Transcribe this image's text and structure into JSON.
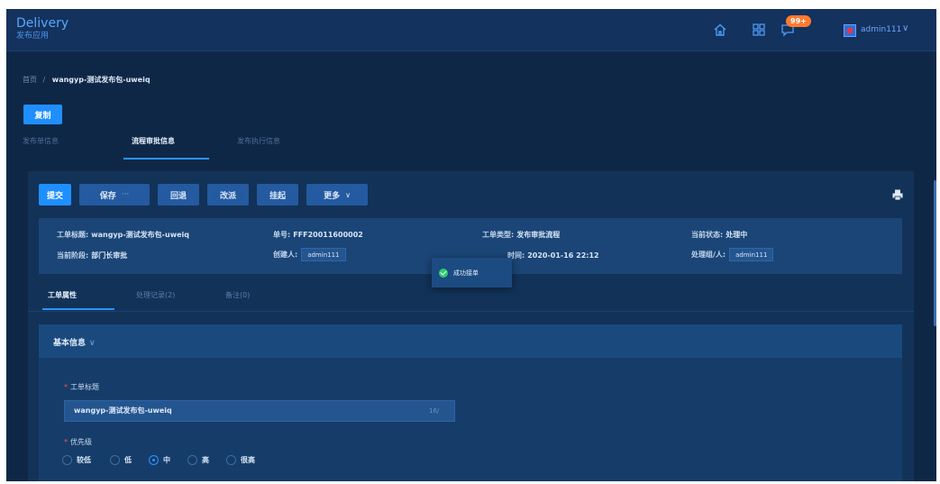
{
  "app": {
    "name": "Delivery",
    "subtitle": "发布应用"
  },
  "topbar": {
    "home_icon": "home-icon",
    "apps_icon": "apps-grid-icon",
    "message_icon": "message-icon",
    "badge": "99+",
    "username": "admin111"
  },
  "breadcrumb": {
    "root": "首页",
    "separator": "/",
    "current": "wangyp-测试发布包-uweiq"
  },
  "copy_button": "复制",
  "page_tabs": [
    "发布单信息",
    "流程审批信息",
    "发布执行信息"
  ],
  "toolbar": {
    "submit": "提交",
    "save": "保存",
    "save_more": "···",
    "rollback": "回退",
    "reassign": "改派",
    "suspend": "挂起",
    "more": "更多",
    "more_caret": "∨"
  },
  "info": {
    "title_label": "工单标题:",
    "title_value": "wangyp-测试发布包-uweiq",
    "no_label": "单号:",
    "no_value": "FFF20011600002",
    "type_label": "工单类型:",
    "type_value": "发布审批流程",
    "status_label": "当前状态:",
    "status_value": "处理中",
    "stage_label": "当前阶段:",
    "stage_value": "部门长审批",
    "creator_label": "创建人:",
    "creator_value": "admin111",
    "time_label": "时间:",
    "time_value": "2020-01-16 22:12",
    "handler_label": "处理组/人:",
    "handler_value": "admin111"
  },
  "toast": {
    "message": "成功接单"
  },
  "sub_tabs": [
    "工单属性",
    "处理记录(2)",
    "备注(0)"
  ],
  "section": {
    "title": "基本信息",
    "chevron": "∨",
    "title_field_label": "工单标题",
    "title_field_value": "wangyp-测试发布包-uweiq",
    "title_field_count": "16/",
    "priority_label": "优先级",
    "priority_options": [
      "较低",
      "低",
      "中",
      "高",
      "很高"
    ],
    "priority_selected": "中"
  },
  "colors": {
    "accent": "#1f8fff",
    "background": "#0f2747",
    "badge": "#ff7a2e",
    "success": "#2ecc71"
  }
}
